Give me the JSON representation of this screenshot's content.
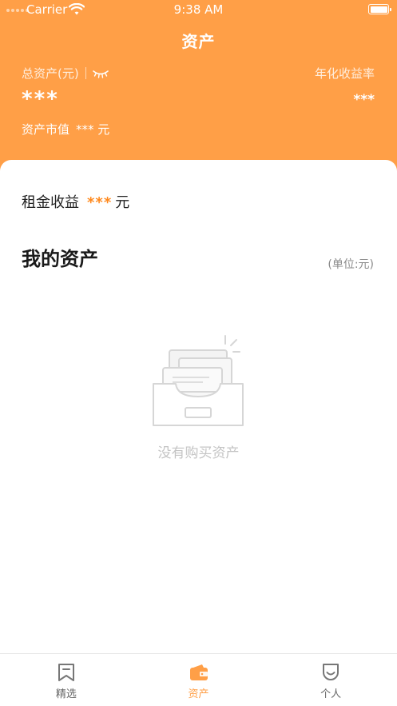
{
  "status_bar": {
    "carrier": "Carrier",
    "time": "9:38 AM"
  },
  "header": {
    "title": "资产",
    "total_assets_label": "总资产(元)",
    "annual_yield_label": "年化收益率",
    "total_assets_value": "***",
    "annual_yield_value": "***",
    "market_value_label": "资产市值",
    "market_value_value": "***",
    "market_value_unit": "元",
    "visibility_icon": "eye-closed-icon"
  },
  "content": {
    "rent_income_label": "租金收益",
    "rent_income_value": "***",
    "rent_income_unit": "元",
    "my_assets_title": "我的资产",
    "unit_label": "(单位:元)",
    "empty_message": "没有购买资产",
    "empty_icon": "empty-box-icon"
  },
  "tabbar": {
    "items": [
      {
        "label": "精选",
        "icon": "bookmark-icon",
        "active": false
      },
      {
        "label": "资产",
        "icon": "wallet-icon",
        "active": true
      },
      {
        "label": "个人",
        "icon": "smiley-icon",
        "active": false
      }
    ]
  },
  "colors": {
    "brand_orange": "#ff9f47",
    "highlight_orange": "#ff8a1f",
    "inactive_gray": "#666666"
  }
}
